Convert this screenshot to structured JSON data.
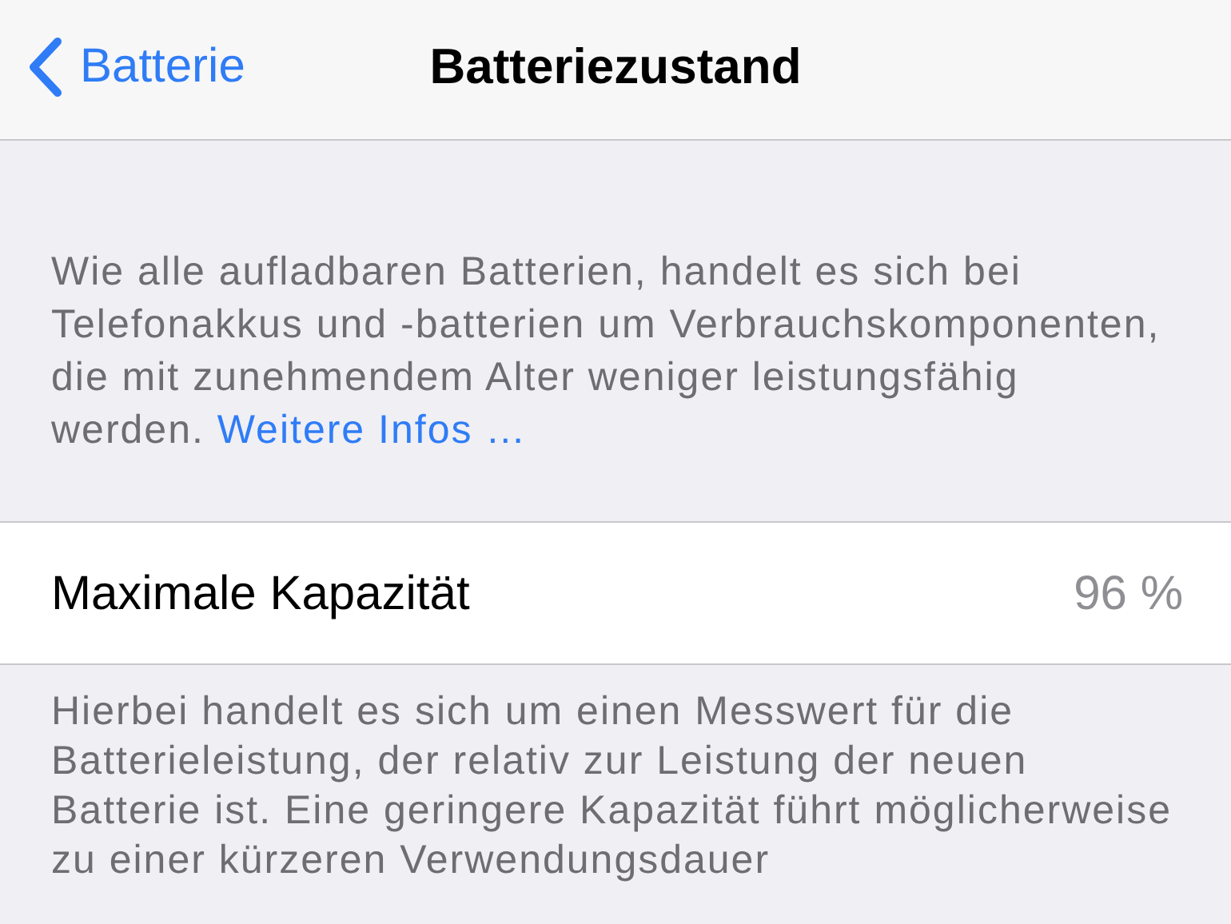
{
  "nav_bar": {
    "back_label": "Batterie",
    "title": "Batteriezustand"
  },
  "intro": {
    "text": "Wie alle aufladbaren Batterien, handelt es sich bei Telefonakkus und -batterien um Verbrauchskomponenten, die mit zunehmendem Alter weniger leistungsfähig werden.",
    "link": "Weitere Infos …"
  },
  "rows": [
    {
      "label": "Maximale Kapazität",
      "value": "96 %"
    }
  ],
  "footer": {
    "text": "Hierbei handelt es sich um einen Messwert für die Batterieleistung, der relativ zur Leistung der neuen Batterie ist. Eine geringere Kapazität führt möglicherweise zu einer kürzeren Verwendungsdauer"
  }
}
